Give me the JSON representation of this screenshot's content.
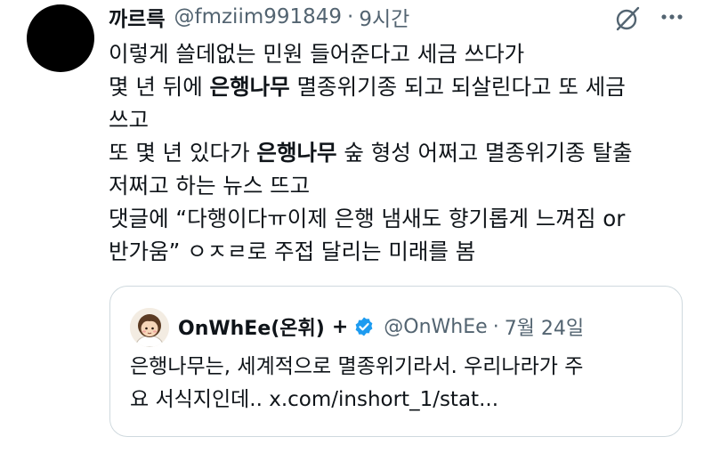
{
  "tweet": {
    "author_name": "까르륵",
    "author_handle": "@fmziim991849",
    "separator": "·",
    "time": "9시간",
    "lines": [
      {
        "parts": [
          {
            "text": "이렇게 쓸데없는 민원 들어준다고 세금 쓰다가",
            "bold": false
          }
        ]
      },
      {
        "parts": [
          {
            "text": "몇 년 뒤에 ",
            "bold": false
          },
          {
            "text": "은행나무",
            "bold": true
          },
          {
            "text": " 멸종위기종 되고 되살린다고 또 세금",
            "bold": false
          }
        ]
      },
      {
        "parts": [
          {
            "text": "쓰고",
            "bold": false
          }
        ]
      },
      {
        "parts": [
          {
            "text": "또 몇 년 있다가 ",
            "bold": false
          },
          {
            "text": "은행나무",
            "bold": true
          },
          {
            "text": " 숲 형성 어쩌고 멸종위기종 탈출",
            "bold": false
          }
        ]
      },
      {
        "parts": [
          {
            "text": "저쩌고 하는 뉴스 뜨고",
            "bold": false
          }
        ]
      },
      {
        "parts": [
          {
            "text": "댓글에 “다행이다ㅠ이제 은행 냄새도 향기롭게 느껴짐 or",
            "bold": false
          }
        ]
      },
      {
        "parts": [
          {
            "text": "반가움” ㅇㅈㄹ로 주접 달리는 미래를 봄",
            "bold": false
          }
        ]
      }
    ]
  },
  "quoted_tweet": {
    "author_name": "OnWhEe(온휘)",
    "plus": "+",
    "author_handle": "@OnWhEe",
    "separator": "·",
    "time": "7월 24일",
    "lines": [
      "은행나무는, 세계적으로 멸종위기라서. 우리나라가 주",
      "요 서식지인데.. x.com/inshort_1/stat..."
    ]
  },
  "colors": {
    "text": "#0f1419",
    "secondary": "#536471",
    "border": "#cfd9de",
    "verified": "#1d9bf0"
  },
  "icons": [
    "grok-icon",
    "more-icon",
    "verified-badge-icon"
  ]
}
